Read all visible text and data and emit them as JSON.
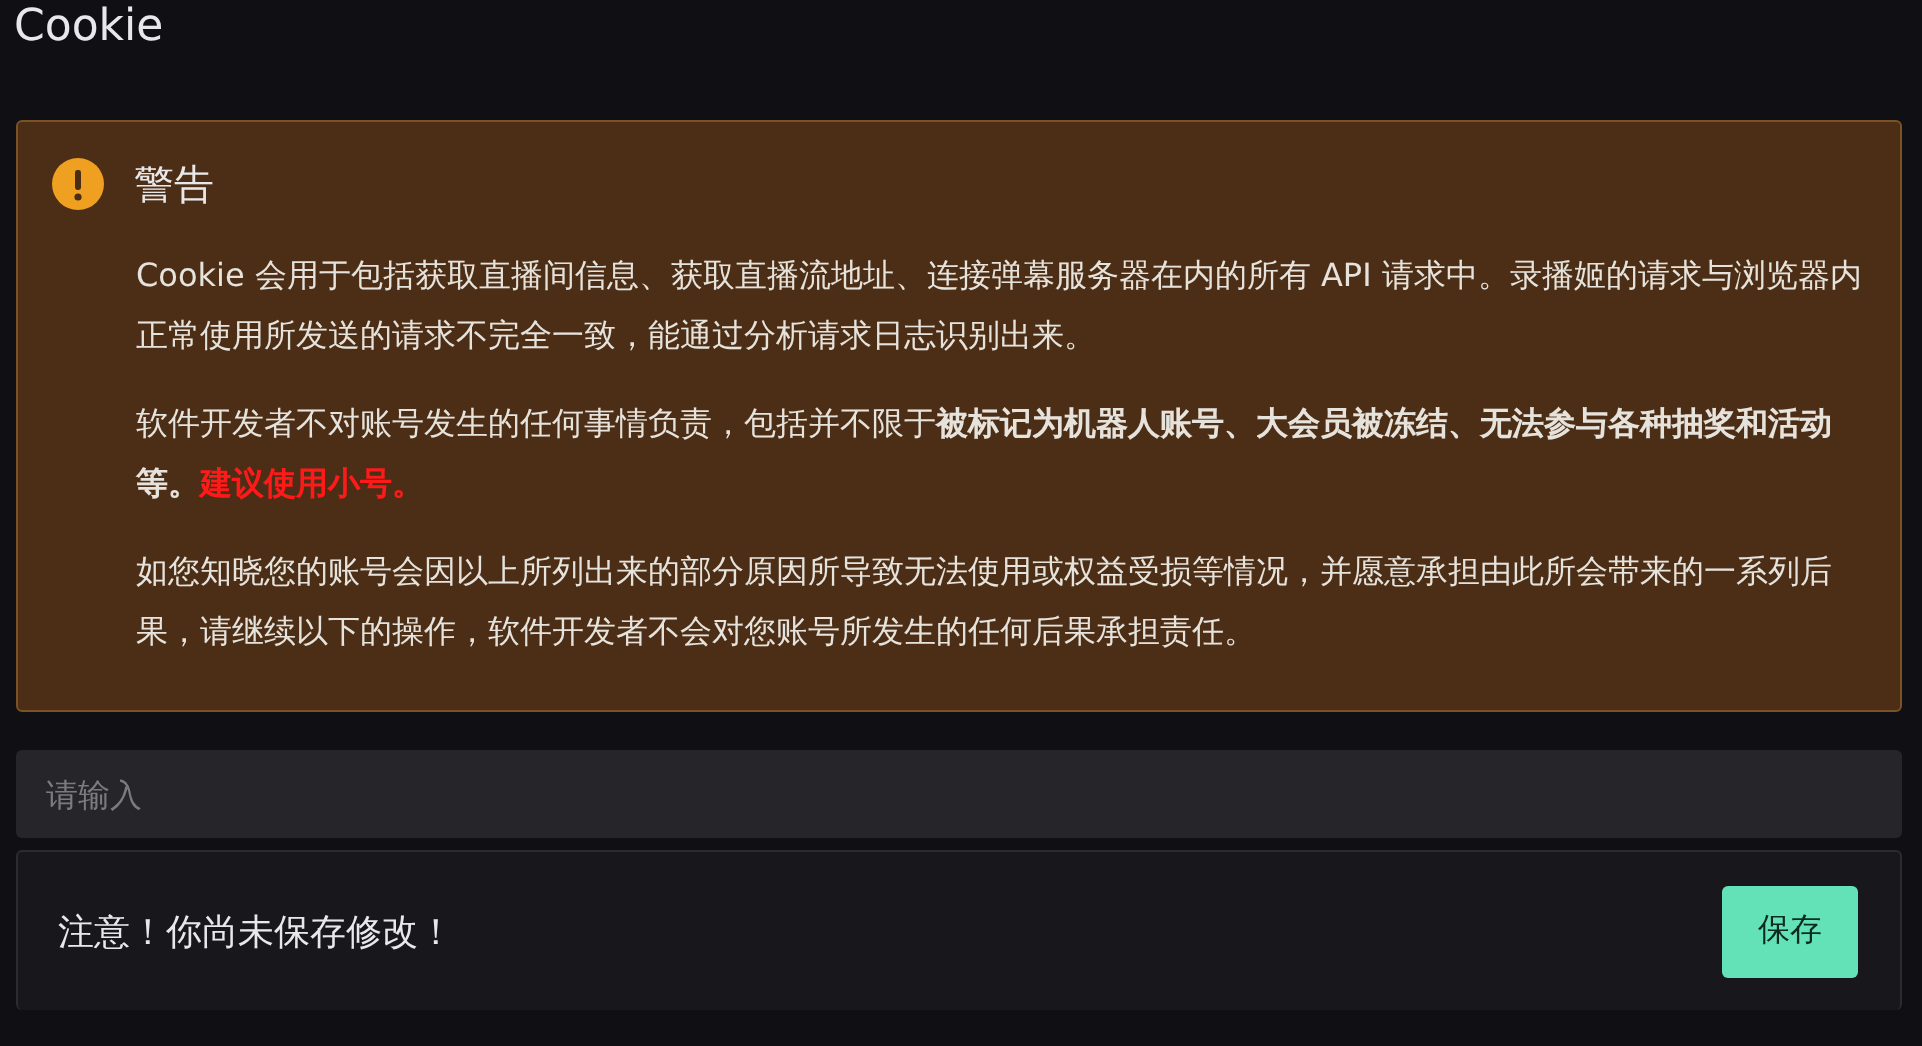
{
  "page_title": "Cookie",
  "alert": {
    "kind": "warning",
    "title": "警告",
    "paragraphs": [
      [
        {
          "kind": "plain",
          "text": "Cookie 会用于包括获取直播间信息、获取直播流地址、连接弹幕服务器在内的所有 API 请求中。录播姬的请求与浏览器内正常使用所发送的请求不完全一致，能通过分析请求日志识别出来。"
        }
      ],
      [
        {
          "kind": "plain",
          "text": "软件开发者不对账号发生的任何事情负责，包括并不限于"
        },
        {
          "kind": "bold",
          "text": "被标记为机器人账号、大会员被冻结、无法参与各种抽奖和活动等。"
        },
        {
          "kind": "danger",
          "text": "建议使用小号。"
        }
      ],
      [
        {
          "kind": "plain",
          "text": "如您知晓您的账号会因以上所列出来的部分原因所导致无法使用或权益受损等情况，并愿意承担由此所会带来的一系列后果，请继续以下的操作，软件开发者不会对您账号所发生的任何后果承担责任。"
        }
      ]
    ]
  },
  "input": {
    "placeholder": "请输入"
  },
  "save_bar": {
    "message": "注意！你尚未保存修改！",
    "button": "保存"
  }
}
